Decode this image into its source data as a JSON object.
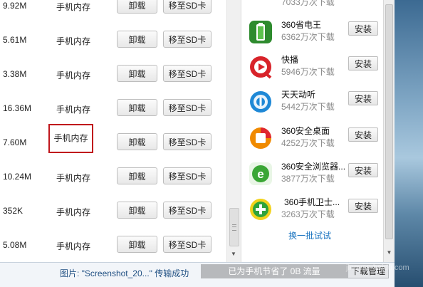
{
  "app_list": {
    "rows": [
      {
        "size": "9.92M",
        "location": "手机内存",
        "uninstall": "卸载",
        "move_sd": "移至SD卡"
      },
      {
        "size": "5.61M",
        "location": "手机内存",
        "uninstall": "卸载",
        "move_sd": "移至SD卡"
      },
      {
        "size": "3.38M",
        "location": "手机内存",
        "uninstall": "卸载",
        "move_sd": "移至SD卡"
      },
      {
        "size": "16.36M",
        "location": "手机内存",
        "uninstall": "卸载",
        "move_sd": "移至SD卡"
      },
      {
        "size": "7.60M",
        "location": "手机内存",
        "uninstall": "卸载",
        "move_sd": "移至SD卡"
      },
      {
        "size": "10.24M",
        "location": "手机内存",
        "uninstall": "卸载",
        "move_sd": "移至SD卡"
      },
      {
        "size": "352K",
        "location": "手机内存",
        "uninstall": "卸载",
        "move_sd": "移至SD卡"
      },
      {
        "size": "5.08M",
        "location": "手机内存",
        "uninstall": "卸载",
        "move_sd": "移至SD卡"
      }
    ]
  },
  "recommend": {
    "top_partial_count": "7033万次下载",
    "apps": [
      {
        "name": "360省电王",
        "downloads": "6362万次下载",
        "install": "安装",
        "icon": "battery-saver-icon",
        "color": "#2e8b2e"
      },
      {
        "name": "快播",
        "downloads": "5946万次下载",
        "install": "安装",
        "icon": "qvod-player-icon",
        "color": "#d8232a"
      },
      {
        "name": "天天动听",
        "downloads": "5442万次下载",
        "install": "安装",
        "icon": "music-player-icon",
        "color": "#1e88d6"
      },
      {
        "name": "360安全桌面",
        "downloads": "4252万次下载",
        "install": "安装",
        "icon": "launcher-icon",
        "color": "#f08a00"
      },
      {
        "name": "360安全浏览器...",
        "downloads": "3877万次下载",
        "install": "安装",
        "icon": "browser-icon",
        "color": "#3aa635"
      },
      {
        "name": "360手机卫士...",
        "downloads": "3263万次下载",
        "install": "安装",
        "icon": "mobile-guard-icon",
        "color": "#2fa33a"
      }
    ],
    "refresh_link": "换一批试试"
  },
  "status_bar": {
    "message": "图片: \"Screenshot_20...\" 传输成功",
    "traffic": "已为手机节省了 0B 流量",
    "download_manager": "下载管理"
  },
  "watermark": "jingyan.baidu.com"
}
